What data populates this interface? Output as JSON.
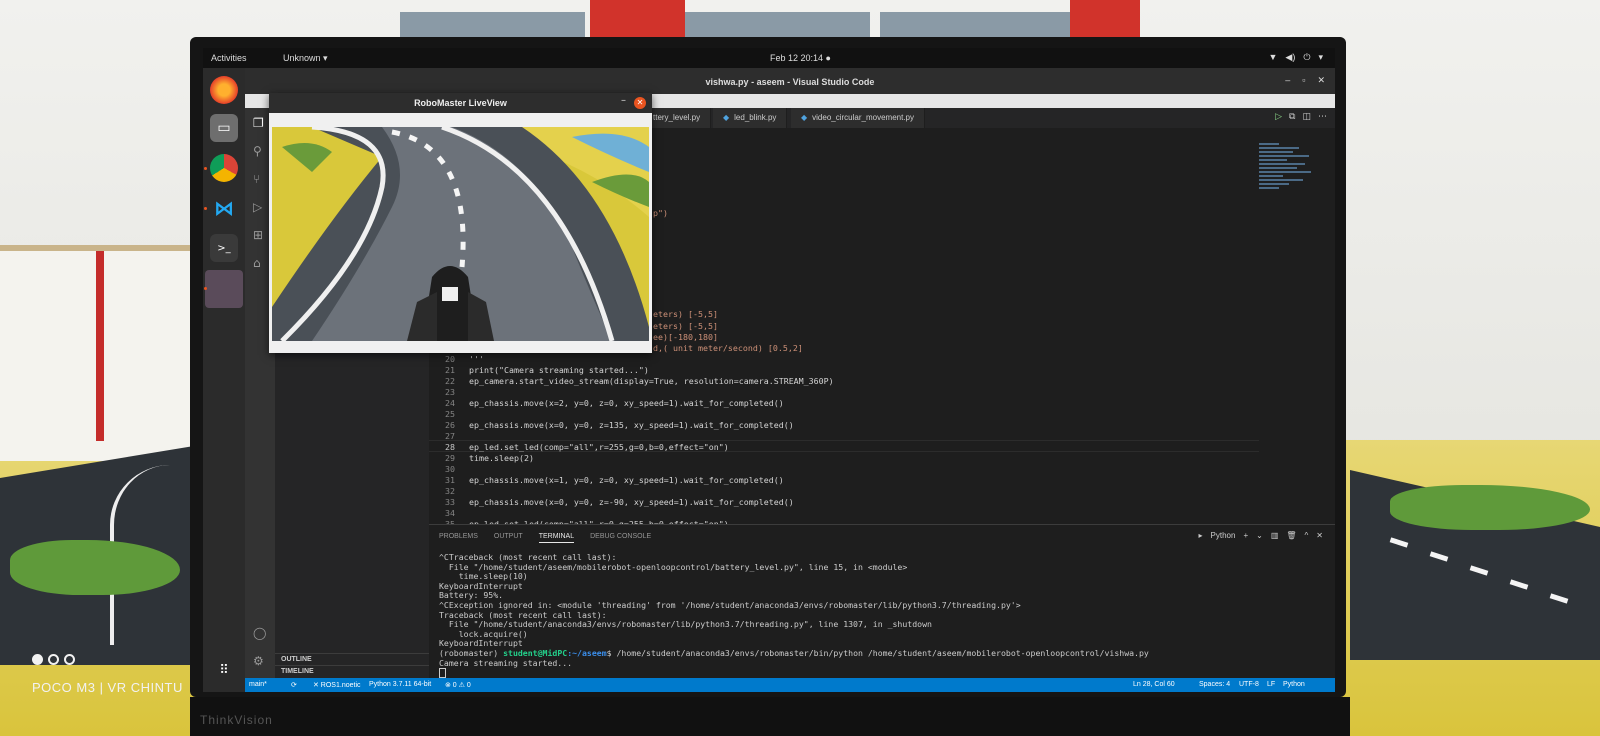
{
  "photo": {
    "stamp_text": "POCO M3 | VR CHINTU",
    "monitor_brand": "ThinkVision"
  },
  "topbar": {
    "activities": "Activities",
    "app_menu": "Unknown ▾",
    "clock": "Feb 12  20:14  ●",
    "tray_icons": [
      "network-icon",
      "volume-icon",
      "power-icon",
      "chevron-down-icon"
    ]
  },
  "dock": {
    "apps": [
      "firefox-icon",
      "files-icon",
      "chrome-icon",
      "vscode-icon",
      "terminal-icon",
      "blank-app-icon",
      "show-apps-icon"
    ]
  },
  "vscode": {
    "title": "vishwa.py - aseem - Visual Studio Code",
    "window_controls": [
      "–",
      "▫",
      "✕"
    ],
    "tabs": [
      "ttery_level.py",
      "led_blink.py",
      "video_circular_movement.py"
    ],
    "sidebar_sections": [
      "OUTLINE",
      "TIMELINE"
    ],
    "code_fragments": [
      {
        "text": "p\")"
      },
      {
        "text": "eters) [-5,5]"
      },
      {
        "text": "eters) [-5,5]"
      },
      {
        "text": "ee)[-180,180]"
      },
      {
        "text": "d,( unit meter/second) [0.5,2]"
      }
    ],
    "code_lines": [
      {
        "n": "20",
        "text": "'''"
      },
      {
        "n": "21",
        "text": "print(\"Camera streaming started...\")"
      },
      {
        "n": "22",
        "text": "ep_camera.start_video_stream(display=True, resolution=camera.STREAM_360P)"
      },
      {
        "n": "23",
        "text": ""
      },
      {
        "n": "24",
        "text": "ep_chassis.move(x=2, y=0, z=0, xy_speed=1).wait_for_completed()"
      },
      {
        "n": "25",
        "text": ""
      },
      {
        "n": "26",
        "text": "ep_chassis.move(x=0, y=0, z=135, xy_speed=1).wait_for_completed()"
      },
      {
        "n": "27",
        "text": ""
      },
      {
        "n": "28",
        "text": "ep_led.set_led(comp=\"all\",r=255,g=0,b=0,effect=\"on\")"
      },
      {
        "n": "29",
        "text": "time.sleep(2)"
      },
      {
        "n": "30",
        "text": ""
      },
      {
        "n": "31",
        "text": "ep_chassis.move(x=1, y=0, z=0, xy_speed=1).wait_for_completed()"
      },
      {
        "n": "32",
        "text": ""
      },
      {
        "n": "33",
        "text": "ep_chassis.move(x=0, y=0, z=-90, xy_speed=1).wait_for_completed()"
      },
      {
        "n": "34",
        "text": ""
      },
      {
        "n": "35",
        "text": "ep_led.set_led(comp=\"all\",r=0,g=255,b=0,effect=\"on\")"
      }
    ],
    "panel": {
      "tabs": [
        "PROBLEMS",
        "OUTPUT",
        "TERMINAL",
        "DEBUG CONSOLE"
      ],
      "active_tab": "TERMINAL",
      "terminal_selector": "Python",
      "controls": [
        "+",
        "⌄",
        "▥",
        "🗑",
        "^",
        "✕"
      ]
    },
    "terminal_lines": [
      "^CTraceback (most recent call last):",
      "  File \"/home/student/aseem/mobilerobot-openloopcontrol/battery_level.py\", line 15, in <module>",
      "    time.sleep(10)",
      "KeyboardInterrupt",
      "Battery: 95%.",
      "^CException ignored in: <module 'threading' from '/home/student/anaconda3/envs/robomaster/lib/python3.7/threading.py'>",
      "Traceback (most recent call last):",
      "  File \"/home/student/anaconda3/envs/robomaster/lib/python3.7/threading.py\", line 1307, in _shutdown",
      "    lock.acquire()",
      "KeyboardInterrupt"
    ],
    "prompt": {
      "env": "(robomaster) ",
      "user": "student@MidPC",
      "path": ":~/aseem",
      "command": "$ /home/student/anaconda3/envs/robomaster/bin/python /home/student/aseem/mobilerobot-openloopcontrol/vishwa.py"
    },
    "terminal_after": "Camera streaming started...",
    "statusbar": {
      "left_branch": "main*",
      "sync": "⟳",
      "remote": "✕ ROS1.noetic",
      "interpreter": "Python 3.7.11 64-bit",
      "problems": "⊗ 0 ⚠ 0",
      "position": "Ln 28, Col 60",
      "spaces": "Spaces: 4",
      "encoding": "UTF-8",
      "eol": "LF",
      "language": "Python"
    }
  },
  "liveview": {
    "title": "RoboMaster LiveView"
  },
  "colors": {
    "accent": "#007acc",
    "ubuntu_orange": "#e95420",
    "editor_bg": "#1e1e1e"
  }
}
